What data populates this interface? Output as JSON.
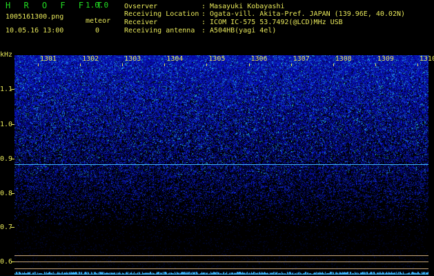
{
  "app": {
    "name": "H R O F F T",
    "version": "1.0.0"
  },
  "file": {
    "name": "1005161300.png",
    "datetime": "10.05.16 13:00"
  },
  "meteor": {
    "label": "meteor",
    "count": "0"
  },
  "info": [
    {
      "label": "Ovserver",
      "value": ": Masayuki Kobayashi"
    },
    {
      "label": "Receiving Location",
      "value": ": Ogata-vill. Akita-Pref. JAPAN (139.96E, 40.02N)"
    },
    {
      "label": "Receiver",
      "value": ": ICOM IC-575 53.7492(@LCD)MHz USB"
    },
    {
      "label": "Receiving antenna",
      "value": ": A504HB(yagi 4el)"
    }
  ],
  "yaxis": {
    "unit": "kHz",
    "ticks": [
      "1.1",
      "1.0",
      "0.9",
      "0.8",
      "0.7",
      "0.6"
    ]
  },
  "minutes": [
    "1301",
    "1302",
    "1303",
    "1304",
    "1305",
    "1306",
    "1307",
    "1308",
    "1309",
    "1310"
  ],
  "colors": {
    "text": "#e8e85a",
    "title": "#22dd22",
    "signal_line": "#3fb6ff",
    "ref_line": "#c9a77a"
  }
}
